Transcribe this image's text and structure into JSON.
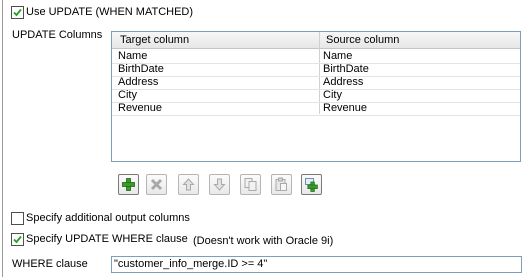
{
  "use_update": {
    "label": "Use UPDATE (WHEN MATCHED)",
    "checked": true
  },
  "update_columns": {
    "label": "UPDATE Columns",
    "headers": [
      "Target column",
      "Source column"
    ],
    "rows": [
      {
        "target": "Name",
        "source": "Name"
      },
      {
        "target": "BirthDate",
        "source": "BirthDate"
      },
      {
        "target": "Address",
        "source": "Address"
      },
      {
        "target": "City",
        "source": "City"
      },
      {
        "target": "Revenue",
        "source": "Revenue"
      }
    ]
  },
  "toolbar": {
    "buttons": [
      {
        "icon": "plus-icon",
        "enabled": true
      },
      {
        "icon": "remove-icon",
        "enabled": false
      },
      {
        "icon": "arrow-up-icon",
        "enabled": false
      },
      {
        "icon": "arrow-down-icon",
        "enabled": false
      },
      {
        "icon": "copy-icon",
        "enabled": false
      },
      {
        "icon": "paste-icon",
        "enabled": false
      },
      {
        "icon": "add-row-icon",
        "enabled": true
      }
    ],
    "accent_green": "#3a9b2a"
  },
  "specify_output": {
    "label": "Specify additional output columns",
    "checked": false
  },
  "specify_where": {
    "label": "Specify UPDATE WHERE clause",
    "checked": true,
    "note": "(Doesn't work with Oracle 9i)"
  },
  "where_clause": {
    "label": "WHERE clause",
    "value": "\"customer_info_merge.ID >= 4\""
  }
}
